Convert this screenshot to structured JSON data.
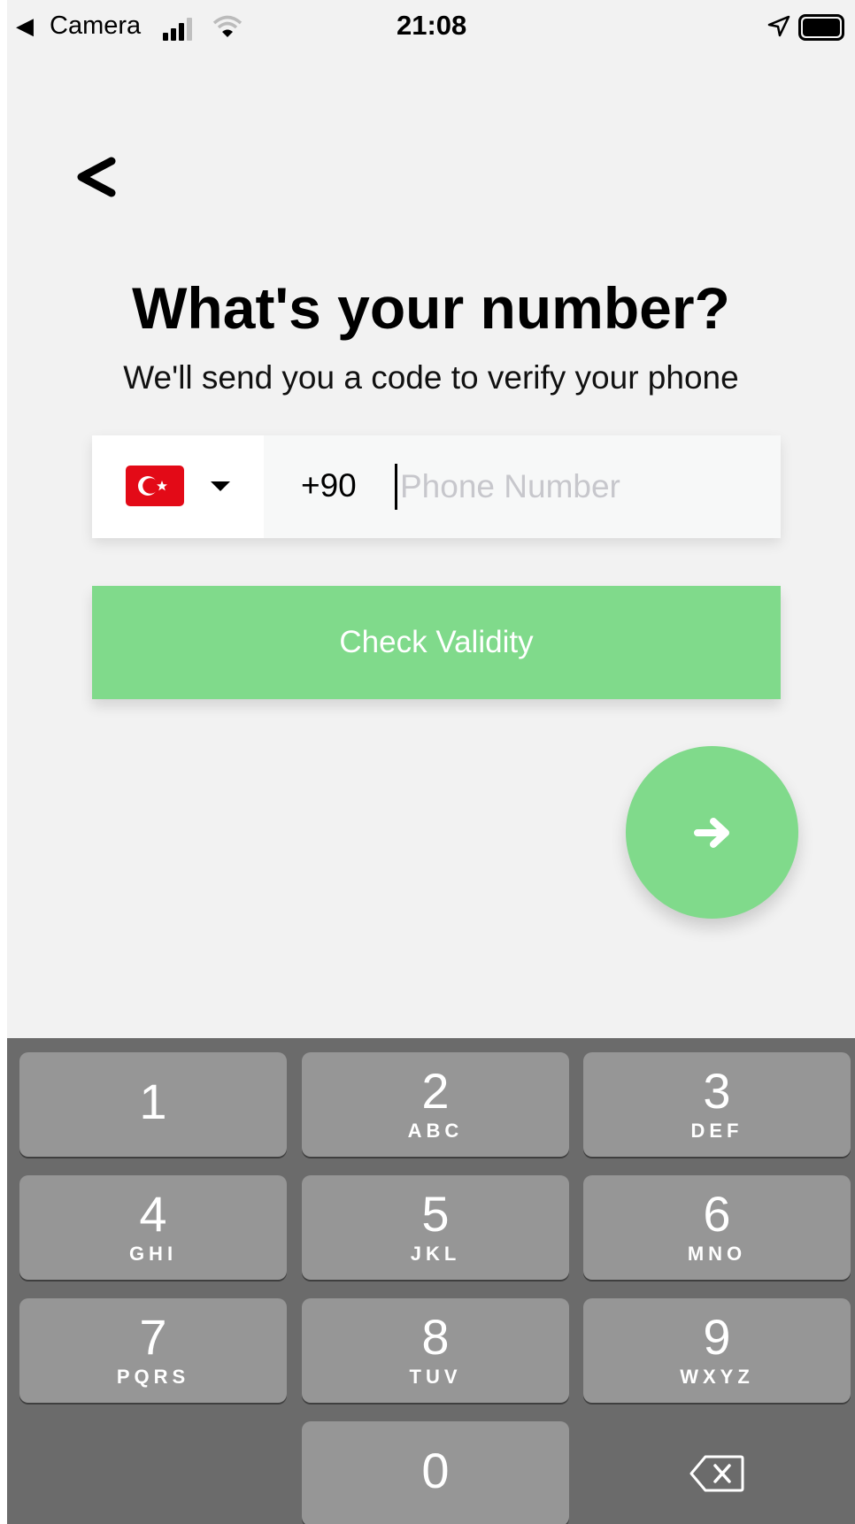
{
  "status_bar": {
    "back_app": "Camera",
    "time": "21:08"
  },
  "header": {
    "title": "What's your number?",
    "subtitle": "We'll send you a code to verify your phone"
  },
  "phone": {
    "country_flag": "turkey-flag",
    "dial_code": "+90",
    "placeholder": "Phone Number",
    "value": ""
  },
  "buttons": {
    "check_label": "Check Validity"
  },
  "colors": {
    "accent": "#80da8b",
    "background": "#f2f2f2",
    "keyboard": "#6b6b6b",
    "key": "#969696"
  },
  "keyboard": {
    "keys": [
      {
        "digit": "1",
        "letters": ""
      },
      {
        "digit": "2",
        "letters": "ABC"
      },
      {
        "digit": "3",
        "letters": "DEF"
      },
      {
        "digit": "4",
        "letters": "GHI"
      },
      {
        "digit": "5",
        "letters": "JKL"
      },
      {
        "digit": "6",
        "letters": "MNO"
      },
      {
        "digit": "7",
        "letters": "PQRS"
      },
      {
        "digit": "8",
        "letters": "TUV"
      },
      {
        "digit": "9",
        "letters": "WXYZ"
      },
      {
        "digit": "0",
        "letters": ""
      }
    ]
  }
}
